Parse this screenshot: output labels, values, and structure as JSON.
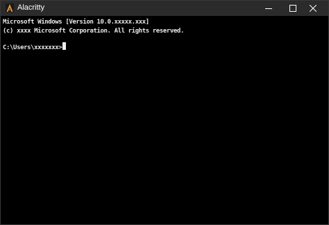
{
  "window": {
    "title": "Alacritty",
    "icons": {
      "app": "alacritty-logo-icon",
      "minimize": "minimize-icon",
      "maximize": "maximize-icon",
      "close": "close-icon"
    },
    "colors": {
      "titlebar": "#2b2b2b",
      "background": "#000000",
      "foreground": "#f0f0f0",
      "accent": "#f0a030"
    }
  },
  "terminal": {
    "lines": [
      "Microsoft Windows [Version 10.0.xxxxx.xxx]",
      "(c) xxxx Microsoft Corporation. All rights reserved."
    ],
    "prompt": "C:\\Users\\xxxxxxx>"
  }
}
